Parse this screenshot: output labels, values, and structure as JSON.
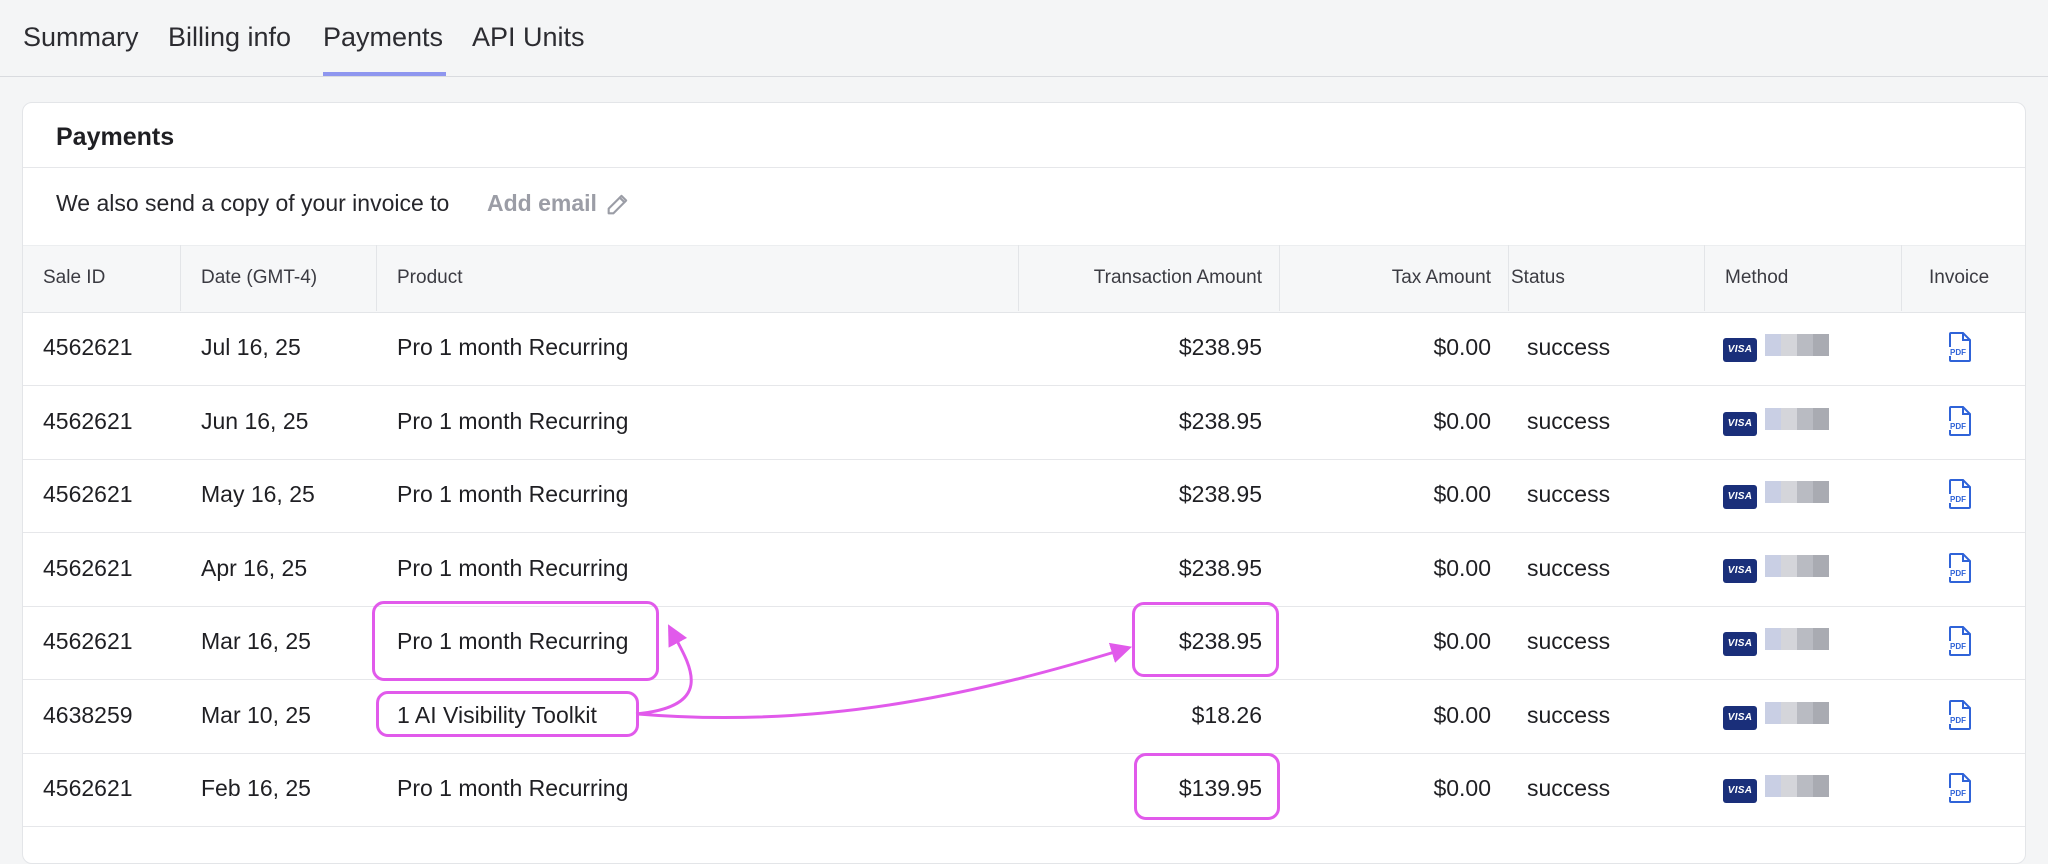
{
  "tabs": [
    {
      "label": "Summary"
    },
    {
      "label": "Billing info"
    },
    {
      "label": "Payments"
    },
    {
      "label": "API Units"
    }
  ],
  "card": {
    "title": "Payments",
    "email_text": "We also send a copy of your invoice to",
    "add_email": "Add email"
  },
  "columns": {
    "sale_id": "Sale ID",
    "date": "Date (GMT-4)",
    "product": "Product",
    "transaction_amount": "Transaction Amount",
    "tax_amount": "Tax Amount",
    "status": "Status",
    "method": "Method",
    "invoice": "Invoice"
  },
  "rows": [
    {
      "sale_id": "4562621",
      "date": "Jul 16, 25",
      "product": "Pro 1 month Recurring",
      "amount": "$238.95",
      "tax": "$0.00",
      "status": "success",
      "method": "VISA"
    },
    {
      "sale_id": "4562621",
      "date": "Jun 16, 25",
      "product": "Pro 1 month Recurring",
      "amount": "$238.95",
      "tax": "$0.00",
      "status": "success",
      "method": "VISA"
    },
    {
      "sale_id": "4562621",
      "date": "May 16, 25",
      "product": "Pro 1 month Recurring",
      "amount": "$238.95",
      "tax": "$0.00",
      "status": "success",
      "method": "VISA"
    },
    {
      "sale_id": "4562621",
      "date": "Apr 16, 25",
      "product": "Pro 1 month Recurring",
      "amount": "$238.95",
      "tax": "$0.00",
      "status": "success",
      "method": "VISA"
    },
    {
      "sale_id": "4562621",
      "date": "Mar 16, 25",
      "product": "Pro 1 month Recurring",
      "amount": "$238.95",
      "tax": "$0.00",
      "status": "success",
      "method": "VISA"
    },
    {
      "sale_id": "4638259",
      "date": "Mar 10, 25",
      "product": "1 AI Visibility Toolkit",
      "amount": "$18.26",
      "tax": "$0.00",
      "status": "success",
      "method": "VISA"
    },
    {
      "sale_id": "4562621",
      "date": "Feb 16, 25",
      "product": "Pro 1 month Recurring",
      "amount": "$139.95",
      "tax": "$0.00",
      "status": "success",
      "method": "VISA"
    }
  ],
  "invoice_icon": "pdf-file-icon",
  "colors": {
    "tab_underline": "#8e96ef",
    "annotation": "#e15aeb",
    "visa_blue": "#1a2f7a",
    "pdf_blue": "#2f63d8"
  }
}
